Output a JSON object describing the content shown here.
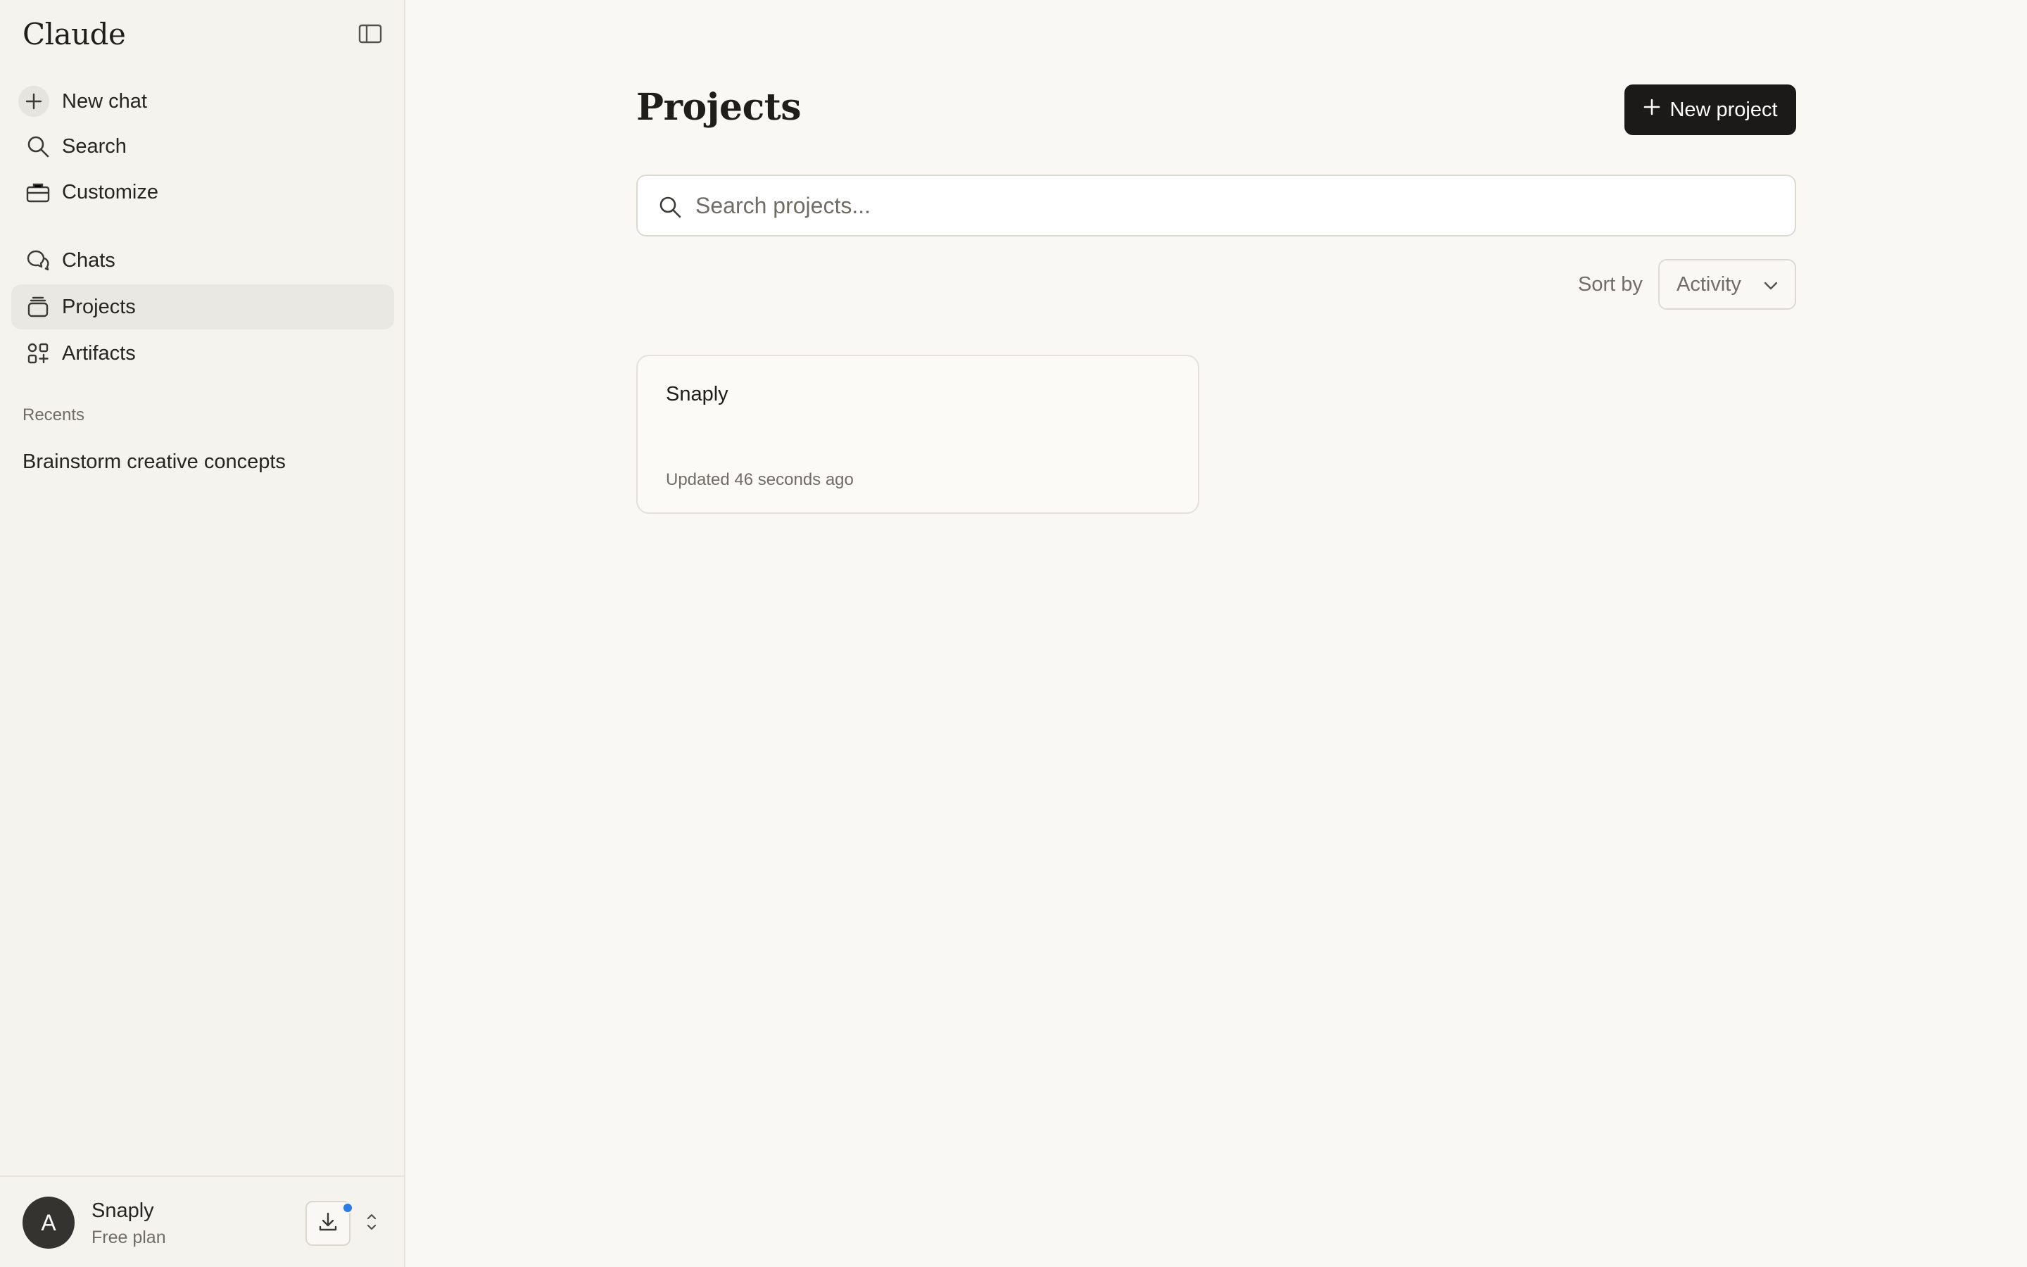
{
  "app": {
    "logo": "Claude"
  },
  "sidebar": {
    "items": [
      {
        "label": "New chat",
        "icon": "plus-icon"
      },
      {
        "label": "Search",
        "icon": "search-icon"
      },
      {
        "label": "Customize",
        "icon": "briefcase-icon"
      },
      {
        "label": "Chats",
        "icon": "chat-bubbles-icon"
      },
      {
        "label": "Projects",
        "icon": "folder-stack-icon",
        "active": true
      },
      {
        "label": "Artifacts",
        "icon": "shapes-icon"
      }
    ],
    "recents_title": "Recents",
    "recents": [
      "Brainstorm creative concepts"
    ]
  },
  "user": {
    "initial": "A",
    "name": "Snaply",
    "plan": "Free plan"
  },
  "main": {
    "title": "Projects",
    "new_project_label": "New project",
    "search_placeholder": "Search projects...",
    "sort_label": "Sort by",
    "sort_value": "Activity",
    "projects": [
      {
        "name": "Snaply",
        "updated": "Updated 46 seconds ago"
      }
    ]
  },
  "colors": {
    "accent": "#1b1a18",
    "notification": "#2d7be5",
    "background": "#f9f8f5",
    "sidebar": "#f4f3ee"
  }
}
